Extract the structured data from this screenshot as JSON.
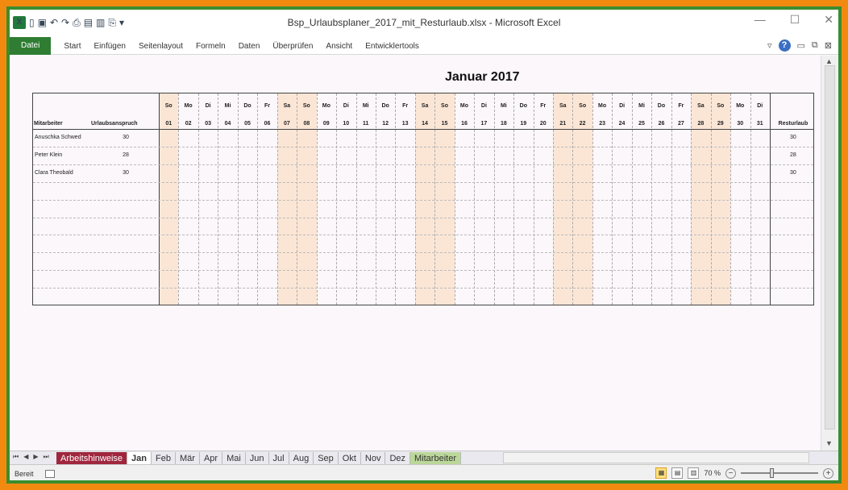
{
  "window": {
    "title": "Bsp_Urlaubsplaner_2017_mit_Resturlaub.xlsx - Microsoft Excel"
  },
  "ribbon": {
    "file_tab": "Datei",
    "tabs": [
      "Start",
      "Einfügen",
      "Seitenlayout",
      "Formeln",
      "Daten",
      "Überprüfen",
      "Ansicht",
      "Entwicklertools"
    ]
  },
  "sheet": {
    "title": "Januar 2017",
    "col_employee": "Mitarbeiter",
    "col_entitlement": "Urlaubsanspruch",
    "col_remaining": "Resturlaub",
    "weekday_headers": [
      "So",
      "Mo",
      "Di",
      "Mi",
      "Do",
      "Fr",
      "Sa",
      "So",
      "Mo",
      "Di",
      "Mi",
      "Do",
      "Fr",
      "Sa",
      "So",
      "Mo",
      "Di",
      "Mi",
      "Do",
      "Fr",
      "Sa",
      "So",
      "Mo",
      "Di",
      "Mi",
      "Do",
      "Fr",
      "Sa",
      "So",
      "Mo",
      "Di"
    ],
    "day_headers": [
      "01",
      "02",
      "03",
      "04",
      "05",
      "06",
      "07",
      "08",
      "09",
      "10",
      "11",
      "12",
      "13",
      "14",
      "15",
      "16",
      "17",
      "18",
      "19",
      "20",
      "21",
      "22",
      "23",
      "24",
      "25",
      "26",
      "27",
      "28",
      "29",
      "30",
      "31"
    ],
    "employees": [
      {
        "name": "Anuschka Schwed",
        "entitlement": "30",
        "remaining": "30"
      },
      {
        "name": "Peter Klein",
        "entitlement": "28",
        "remaining": "28"
      },
      {
        "name": "Clara Theobald",
        "entitlement": "30",
        "remaining": "30"
      }
    ],
    "weekend_color": "#fbe6d6"
  },
  "sheet_tabs": [
    "Arbeitshinweise",
    "Jan",
    "Feb",
    "Mär",
    "Apr",
    "Mai",
    "Jun",
    "Jul",
    "Aug",
    "Sep",
    "Okt",
    "Nov",
    "Dez",
    "Mitarbeiter"
  ],
  "active_tab": "Jan",
  "status": {
    "ready": "Bereit",
    "zoom": "70 %"
  }
}
